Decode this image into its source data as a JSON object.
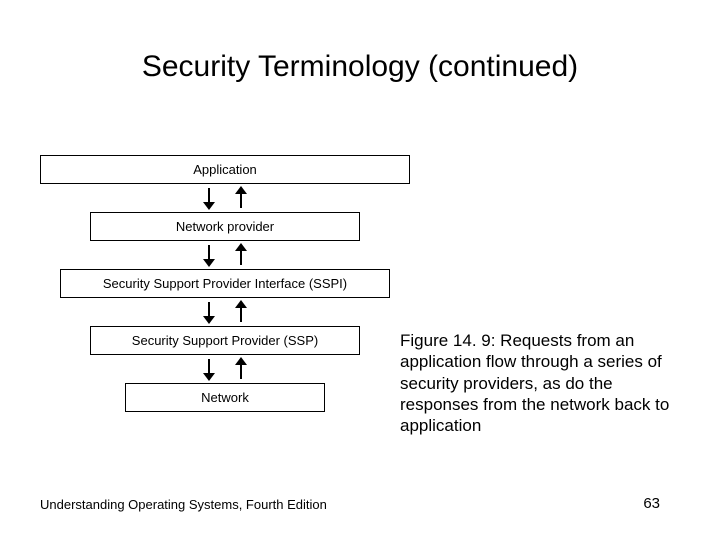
{
  "title": "Security Terminology (continued)",
  "diagram": {
    "boxes": [
      "Application",
      "Network provider",
      "Security Support Provider Interface (SSPI)",
      "Security Support Provider (SSP)",
      "Network"
    ]
  },
  "caption": "Figure 14. 9: Requests from an application flow through a series of security providers, as do the responses from the network back to application",
  "footer": {
    "left": "Understanding Operating Systems, Fourth Edition",
    "page": "63"
  }
}
